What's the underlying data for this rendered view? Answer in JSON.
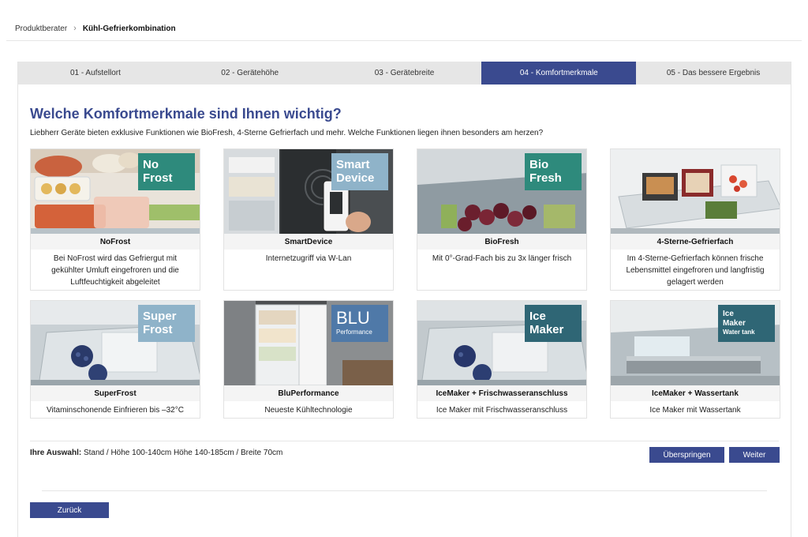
{
  "breadcrumb": {
    "root": "Produktberater",
    "current": "Kühl-Gefrierkombination"
  },
  "steps": [
    {
      "label": "01 - Aufstellort"
    },
    {
      "label": "02 - Gerätehöhe"
    },
    {
      "label": "03 - Gerätebreite"
    },
    {
      "label": "04 - Komfortmerkmale",
      "active": true
    },
    {
      "label": "05 - Das bessere Ergebnis"
    }
  ],
  "heading": "Welche Komfortmerkmale sind Ihnen wichtig?",
  "intro": "Liebherr Geräte bieten exklusive Funktionen wie BioFresh, 4-Sterne Gefrierfach und mehr. Welche Funktionen liegen ihnen besonders am herzen?",
  "features": [
    {
      "title": "NoFrost",
      "description": "Bei NoFrost wird das Gefriergut mit gekühlter Umluft eingefroren und die Luftfeuchtigkeit abgeleitet",
      "badge_line1": "No",
      "badge_line2": "Frost",
      "badge_color": "#2e8a7c"
    },
    {
      "title": "SmartDevice",
      "description": "Internetzugriff via W-Lan",
      "badge_line1": "Smart",
      "badge_line2": "Device",
      "badge_color": "#8fb3c9"
    },
    {
      "title": "BioFresh",
      "description": "Mit 0°-Grad-Fach bis zu 3x länger frisch",
      "badge_line1": "Bio",
      "badge_line2": "Fresh",
      "badge_color": "#2e8a7c"
    },
    {
      "title": "4-Sterne-Gefrierfach",
      "description": "Im 4-Sterne-Gefrierfach können frische Lebensmittel eingefroren und langfristig gelagert werden"
    },
    {
      "title": "SuperFrost",
      "description": "Vitaminschonende Einfrieren bis –32°C",
      "badge_line1": "Super",
      "badge_line2": "Frost",
      "badge_color": "#8fb3c9"
    },
    {
      "title": "BluPerformance",
      "description": "Neueste Kühltechnologie",
      "badge_line1": "BLU",
      "badge_line2": "Performance",
      "badge_color": "#4f79a8"
    },
    {
      "title": "IceMaker + Frischwasseranschluss",
      "description": "Ice Maker mit Frischwasseranschluss",
      "badge_line1": "Ice",
      "badge_line2": "Maker",
      "badge_color": "#2f6675"
    },
    {
      "title": "IceMaker + Wassertank",
      "description": "Ice Maker mit Wassertank",
      "badge_line1": "Ice",
      "badge_line2": "Maker",
      "badge_line3": "Water tank",
      "badge_color": "#2f6675"
    }
  ],
  "selection": {
    "label": "Ihre Auswahl:",
    "value": "Stand / Höhe 100-140cm Höhe 140-185cm / Breite 70cm"
  },
  "buttons": {
    "skip": "Überspringen",
    "next": "Weiter",
    "back": "Zurück"
  },
  "colors": {
    "accent": "#3a4a8f",
    "step_bar": "#e6e6e6"
  },
  "icons": {
    "breadcrumb_separator": "chevron-right-icon"
  }
}
